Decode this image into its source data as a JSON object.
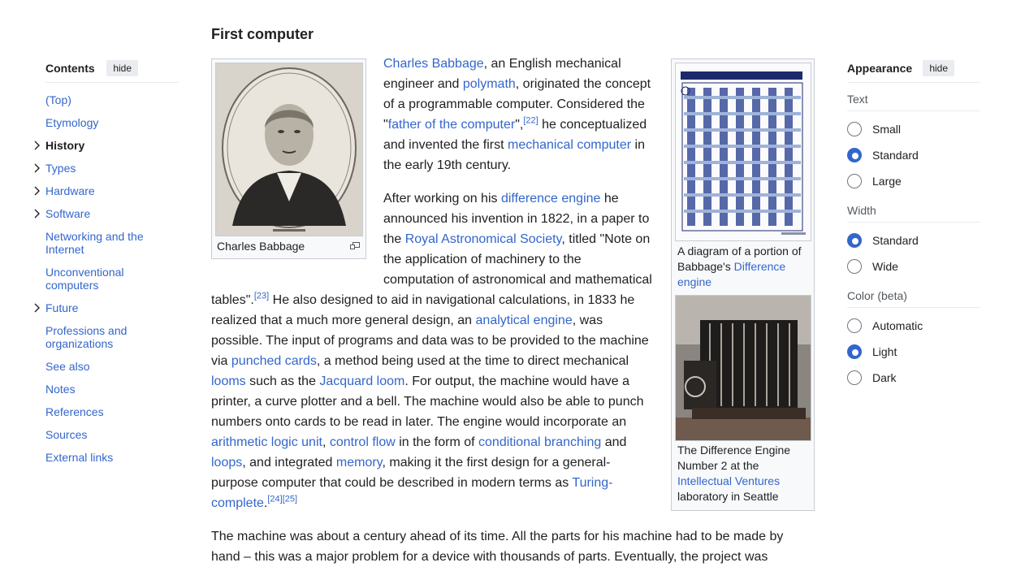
{
  "toc": {
    "title": "Contents",
    "hide_label": "hide",
    "items": [
      {
        "label": "(Top)"
      },
      {
        "label": "Etymology"
      },
      {
        "label": "History"
      },
      {
        "label": "Types"
      },
      {
        "label": "Hardware"
      },
      {
        "label": "Software"
      },
      {
        "label": "Networking and the Internet"
      },
      {
        "label": "Unconventional computers"
      },
      {
        "label": "Future"
      },
      {
        "label": "Professions and organizations"
      },
      {
        "label": "See also"
      },
      {
        "label": "Notes"
      },
      {
        "label": "References"
      },
      {
        "label": "Sources"
      },
      {
        "label": "External links"
      }
    ]
  },
  "article": {
    "section_title": "First computer",
    "p1": {
      "l1": [
        "Charles Babbage",
        ", an English mechanical"
      ],
      "l2": [
        "engineer and ",
        "polymath",
        ", originated the concept"
      ],
      "l3": "of a programmable computer. Considered the",
      "l4": [
        "\"",
        "father of the computer",
        "\",",
        "[22]",
        " he conceptualized"
      ],
      "l5": [
        "and invented the first ",
        "mechanical computer",
        " in"
      ],
      "l6": "the early 19th century."
    },
    "p2": {
      "l1": [
        "After working on his ",
        "difference engine",
        " he"
      ],
      "l2": "announced his invention in 1822, in a paper to",
      "l3": [
        "the ",
        "Royal Astronomical Society",
        ", titled \"Note on"
      ],
      "l4": "the application of machinery to the",
      "l5": "computation of astronomical and mathematical",
      "l6": [
        "tables\".",
        "[23]",
        " He also designed to aid in navigational calculations, in 1833 he"
      ],
      "l7": [
        "realized that a much more general design, an ",
        "analytical engine",
        ", was"
      ],
      "l8": "possible. The input of programs and data was to be provided to the machine",
      "l9": [
        "via ",
        "punched cards",
        ", a method being used at the time to direct mechanical"
      ],
      "l10": [
        "looms",
        " such as the ",
        "Jacquard loom",
        ". For output, the machine would have a"
      ],
      "l11": "printer, a curve plotter and a bell. The machine would also be able to punch",
      "l12": "numbers onto cards to be read in later. The engine would incorporate an",
      "l13": [
        "arithmetic logic unit",
        ", ",
        "control flow",
        " in the form of ",
        "conditional branching",
        " and"
      ],
      "l14": [
        "loops",
        ", and integrated ",
        "memory",
        ", making it the first design for a general-"
      ],
      "l15": [
        "purpose computer that could be described in modern terms as ",
        "Turing-"
      ],
      "l16": [
        "complete",
        ".",
        "[24]",
        "[25]"
      ]
    },
    "p3": {
      "l1": "The machine was about a century ahead of its time. All the parts for his machine had to be made by",
      "l2": "hand – this was a major problem for a device with thousands of parts. Eventually, the project was"
    },
    "figure_babbage": {
      "caption": "Charles Babbage"
    },
    "figure_diagram": {
      "caption_l1": "A diagram of a portion of",
      "caption_l2": [
        "Babbage's ",
        "Difference"
      ],
      "caption_l3": "engine"
    },
    "figure_engine2": {
      "caption_l1": "The Difference Engine",
      "caption_l2": "Number 2 at the",
      "caption_l3": "Intellectual Ventures",
      "caption_l4": "laboratory in Seattle"
    }
  },
  "appearance": {
    "title": "Appearance",
    "hide_label": "hide",
    "text": {
      "label": "Text",
      "options": [
        "Small",
        "Standard",
        "Large"
      ],
      "selected": "Standard"
    },
    "width": {
      "label": "Width",
      "options": [
        "Standard",
        "Wide"
      ],
      "selected": "Standard"
    },
    "color": {
      "label": "Color (beta)",
      "options": [
        "Automatic",
        "Light",
        "Dark"
      ],
      "selected": "Light"
    }
  },
  "colors": {
    "link": "#3366cc",
    "text": "#202122",
    "radio_on": "#3366cc",
    "border": "#c8ccd1"
  }
}
